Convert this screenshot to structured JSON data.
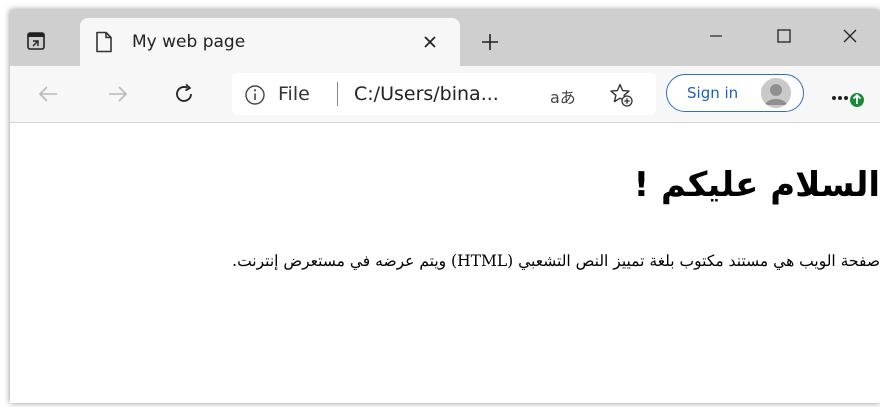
{
  "tab": {
    "title": "My web page"
  },
  "address_bar": {
    "scheme_label": "File",
    "url": "C:/Users/bina...",
    "read_aloud_label": "aあ"
  },
  "account": {
    "sign_in_label": "Sign in"
  },
  "page": {
    "heading": "السلام عليكم !",
    "paragraph": "صفحة الويب هي مستند مكتوب بلغة تمييز النص التشعبي (HTML) ويتم عرضه في مستعرض إنترنت."
  },
  "colors": {
    "titlebar_bg": "#cfcfcf",
    "toolbar_bg": "#f7f7f7",
    "signin_border": "#2e6fc4",
    "notification_badge": "#1a8a3a"
  },
  "icons": {
    "tab_actions": "tab-actions-icon",
    "page": "page-icon",
    "tab_close": "close-icon",
    "new_tab": "plus-icon",
    "minimize": "minimize-icon",
    "maximize": "maximize-icon",
    "close_window": "close-icon",
    "back": "back-arrow-icon",
    "forward": "forward-arrow-icon",
    "refresh": "refresh-icon",
    "info": "info-icon",
    "favorites": "add-favorite-icon",
    "avatar": "avatar-icon",
    "more": "more-icon"
  }
}
